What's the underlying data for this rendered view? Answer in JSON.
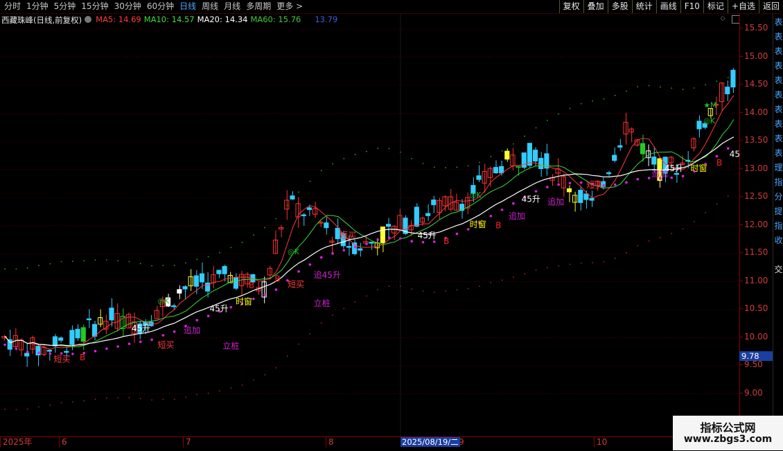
{
  "toolbar": {
    "periods": [
      "分时",
      "1分钟",
      "5分钟",
      "15分钟",
      "30分钟",
      "60分钟",
      "日线",
      "周线",
      "月线",
      "多周期",
      "更多 >"
    ],
    "active_period": "日线",
    "actions": [
      "复权",
      "叠加",
      "多股",
      "统计",
      "画线",
      "F10",
      "标记",
      "+自选",
      "返回"
    ]
  },
  "legend": {
    "stock_title": "西藏珠峰(日线,前复权)",
    "ma5_label": "MA5: 14.69",
    "ma10_label": "MA10: 14.57",
    "ma20_label": "MA20: 14.34",
    "ma60_label": "MA60: 15.76",
    "extra_value": "13.79",
    "colors": {
      "ma5": "#ff3b3b",
      "ma10": "#3bdc3b",
      "ma20": "#ffffff",
      "ma60": "#3ec93e",
      "extra": "#3a5fe6"
    }
  },
  "price_axis": {
    "ticks": [
      "15.50",
      "15.00",
      "14.50",
      "14.00",
      "13.50",
      "13.00",
      "12.50",
      "12.00",
      "11.50",
      "11.00",
      "10.50",
      "10.00",
      "9.50",
      "9.00"
    ],
    "current_price": "9.78"
  },
  "date_axis": {
    "labels": [
      "2025年",
      "6",
      "7",
      "8",
      "9",
      "10"
    ],
    "cursor_date": "2025/08/19/二"
  },
  "right_strip_chars": [
    "表",
    "表",
    "表",
    "表",
    "表",
    "表",
    "表",
    "表",
    "表",
    "表",
    "理",
    "指",
    "分",
    "提",
    "指",
    "收",
    "",
    "交"
  ],
  "chart_annotations": {
    "labels": [
      {
        "text": "短买",
        "color": "#ff3a3a",
        "price": 9.57,
        "bar": 2
      },
      {
        "text": "B",
        "color": "#ff2020",
        "price": 9.6,
        "bar": 4
      },
      {
        "text": "短买",
        "color": "#ff3a3a",
        "price": 9.82,
        "bar": 10
      },
      {
        "text": "追加",
        "color": "#d020d0",
        "price": 10.08,
        "bar": 12
      },
      {
        "text": "45升",
        "color": "#ffffff",
        "price": 10.12,
        "bar": 8
      },
      {
        "text": "立桩",
        "color": "#d020d0",
        "price": 9.8,
        "bar": 15
      },
      {
        "text": "45升",
        "color": "#ffffff",
        "price": 10.47,
        "bar": 14
      },
      {
        "text": "时窗",
        "color": "#ffff00",
        "price": 10.59,
        "bar": 16
      },
      {
        "text": "B",
        "color": "#ff2020",
        "price": 10.88,
        "bar": 17
      },
      {
        "text": "B",
        "color": "#ff2020",
        "price": 11.0,
        "bar": 19
      },
      {
        "text": "短买",
        "color": "#ff3a3a",
        "price": 10.9,
        "bar": 20
      },
      {
        "text": "立桩",
        "color": "#d020d0",
        "price": 10.56,
        "bar": 22
      },
      {
        "text": "追45升",
        "color": "#d020d0",
        "price": 11.07,
        "bar": 22
      },
      {
        "text": "短买",
        "color": "#ff3a3a",
        "price": 11.77,
        "bar": 24
      },
      {
        "text": "45升",
        "color": "#ffffff",
        "price": 11.77,
        "bar": 30
      },
      {
        "text": "B",
        "color": "#ff2020",
        "price": 11.67,
        "bar": 32
      },
      {
        "text": "时窗",
        "color": "#ffff00",
        "price": 11.97,
        "bar": 34
      },
      {
        "text": "B",
        "color": "#ff2020",
        "price": 11.95,
        "bar": 36
      },
      {
        "text": "追加",
        "color": "#d020d0",
        "price": 12.12,
        "bar": 37
      },
      {
        "text": "45升",
        "color": "#ffffff",
        "price": 12.42,
        "bar": 38
      },
      {
        "text": "追加",
        "color": "#d020d0",
        "price": 12.37,
        "bar": 40
      },
      {
        "text": "短买",
        "color": "#ff3a3a",
        "price": 12.67,
        "bar": 43
      },
      {
        "text": "追加",
        "color": "#d020d0",
        "price": 12.87,
        "bar": 48
      },
      {
        "text": "45升",
        "color": "#ffffff",
        "price": 12.97,
        "bar": 49
      },
      {
        "text": "时窗",
        "color": "#ffff00",
        "price": 12.97,
        "bar": 51
      },
      {
        "text": "B",
        "color": "#ff2020",
        "price": 13.07,
        "bar": 53
      },
      {
        "text": "45升",
        "color": "#ffffff",
        "price": 13.22,
        "bar": 54
      }
    ],
    "markers": [
      {
        "text": "◎K",
        "color": "#20c020",
        "price": 10.61,
        "bar": 10
      },
      {
        "text": "◎K",
        "color": "#20c020",
        "price": 11.49,
        "bar": 20
      },
      {
        "text": "◎K",
        "color": "#20c020",
        "price": 12.5,
        "bar": 34
      },
      {
        "text": "◎K",
        "color": "#20c020",
        "price": 13.82,
        "bar": 52
      },
      {
        "text": "★M",
        "color": "#20c020",
        "price": 14.1,
        "bar": 52
      }
    ]
  }
}
